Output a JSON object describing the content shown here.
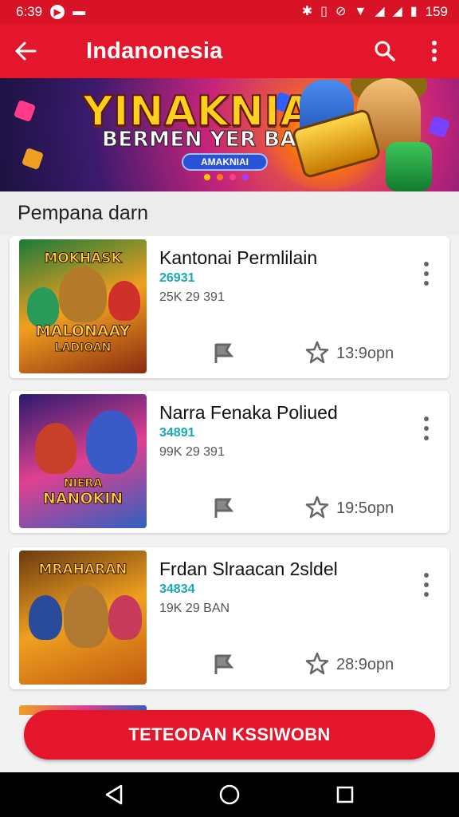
{
  "statusbar": {
    "time": "6:39",
    "battery": "159"
  },
  "appbar": {
    "title": "Indanonesia"
  },
  "banner": {
    "headline": "YINAKNIAI",
    "subline": "BERMEN YER BAALIE",
    "button_label": "AMAKNIAI",
    "dot_colors": [
      "#ffcc00",
      "#ff7a1a",
      "#ff3b8a",
      "#a040ff"
    ]
  },
  "section": {
    "title": "Pempana darn"
  },
  "cards": [
    {
      "name": "Kantonai Permlilain",
      "code": "26931",
      "meta": "25K 29 391",
      "time": "13:9opn",
      "thumb_title_top": "MOKHASK",
      "thumb_title_bottom": "MALONAAY",
      "thumb_title_bottom2": "LADIOAN",
      "bg": [
        "#1a7a3a",
        "#f0a020",
        "#8a2a10"
      ]
    },
    {
      "name": "Narra Fenaka Poliued",
      "code": "34891",
      "meta": "99K 29 391",
      "time": "19:5opn",
      "thumb_title_top": "",
      "thumb_title_bottom": "NIERA",
      "thumb_title_bottom2": "NANOKIN",
      "bg": [
        "#2b1a6e",
        "#e04090",
        "#3060c0"
      ]
    },
    {
      "name": "Frdan Slraacan 2sldel",
      "code": "34834",
      "meta": "19K 29 BAN",
      "time": "28:9opn",
      "thumb_title_top": "MRAHARAN",
      "thumb_title_bottom": "",
      "thumb_title_bottom2": "",
      "bg": [
        "#6a3a10",
        "#f0a020",
        "#c05a10"
      ]
    }
  ],
  "cta": {
    "label": "TETEODAN KSSIWOBN"
  }
}
